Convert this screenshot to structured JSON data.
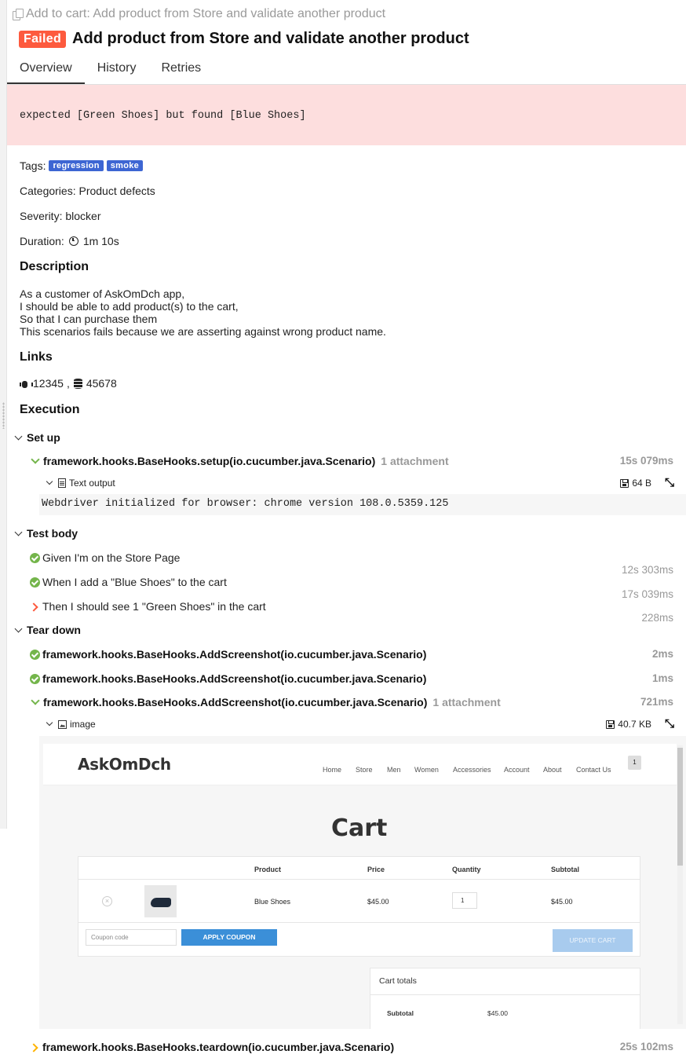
{
  "header": {
    "breadcrumb": "Add to cart: Add product from Store and validate another product",
    "status": "Failed",
    "title": "Add product from Store and validate another product"
  },
  "tabs": [
    "Overview",
    "History",
    "Retries"
  ],
  "error_message": "expected [Green Shoes] but found [Blue Shoes]",
  "meta": {
    "tags_label": "Tags:",
    "tags": [
      "regression",
      "smoke"
    ],
    "categories": "Categories: Product defects",
    "severity": "Severity: blocker",
    "duration_label": "Duration:",
    "duration": "1m 10s"
  },
  "description": {
    "heading": "Description",
    "lines": [
      "As a customer of AskOmDch app,",
      "I should be able to add product(s) to the cart,",
      "So that I can purchase them",
      "This scenarios fails because we are asserting against wrong product name."
    ]
  },
  "links": {
    "heading": "Links",
    "issue": "12345",
    "separator": ",",
    "tms": "45678"
  },
  "execution": {
    "heading": "Execution",
    "setup": {
      "label": "Set up",
      "hook": "framework.hooks.BaseHooks.setup(io.cucumber.java.Scenario)",
      "attachments": "1 attachment",
      "duration": "15s 079ms",
      "attachment_name": "Text output",
      "attachment_size": "64 B",
      "output": "Webdriver initialized for browser: chrome version 108.0.5359.125"
    },
    "body": {
      "label": "Test body",
      "steps": [
        {
          "text": "Given I'm on the Store Page",
          "duration": "12s 303ms",
          "status": "passed"
        },
        {
          "text": "When I add a \"Blue Shoes\" to the cart",
          "duration": "17s 039ms",
          "status": "passed"
        },
        {
          "text": "Then I should see 1 \"Green Shoes\" in the cart",
          "duration": "228ms",
          "status": "failed"
        }
      ]
    },
    "teardown": {
      "label": "Tear down",
      "hooks": [
        {
          "text": "framework.hooks.BaseHooks.AddScreenshot(io.cucumber.java.Scenario)",
          "duration": "2ms"
        },
        {
          "text": "framework.hooks.BaseHooks.AddScreenshot(io.cucumber.java.Scenario)",
          "duration": "1ms"
        },
        {
          "text": "framework.hooks.BaseHooks.AddScreenshot(io.cucumber.java.Scenario)",
          "attachments": "1 attachment",
          "duration": "721ms"
        }
      ],
      "attachment_name": "image",
      "attachment_size": "40.7 KB",
      "last_hook": "framework.hooks.BaseHooks.teardown(io.cucumber.java.Scenario)",
      "last_duration": "25s 102ms"
    }
  },
  "screenshot": {
    "logo": "AskOmDch",
    "menu": [
      "Home",
      "Store",
      "Men",
      "Women",
      "Accessories",
      "Account",
      "About",
      "Contact Us"
    ],
    "cart_count": "1",
    "heading": "Cart",
    "columns": [
      "Product",
      "Price",
      "Quantity",
      "Subtotal"
    ],
    "row": {
      "remove": "×",
      "product": "Blue Shoes",
      "price": "$45.00",
      "quantity": "1",
      "subtotal": "$45.00"
    },
    "coupon_placeholder": "Coupon code",
    "apply_coupon": "APPLY COUPON",
    "update_cart": "UPDATE CART",
    "totals_title": "Cart totals",
    "subtotal_label": "Subtotal",
    "subtotal_value": "$45.00"
  },
  "colors": {
    "failed": "#fd5a3e",
    "passed": "#74b54b",
    "tag": "#3d66d3",
    "error_bg": "#fddede",
    "broken": "#ffb300"
  }
}
